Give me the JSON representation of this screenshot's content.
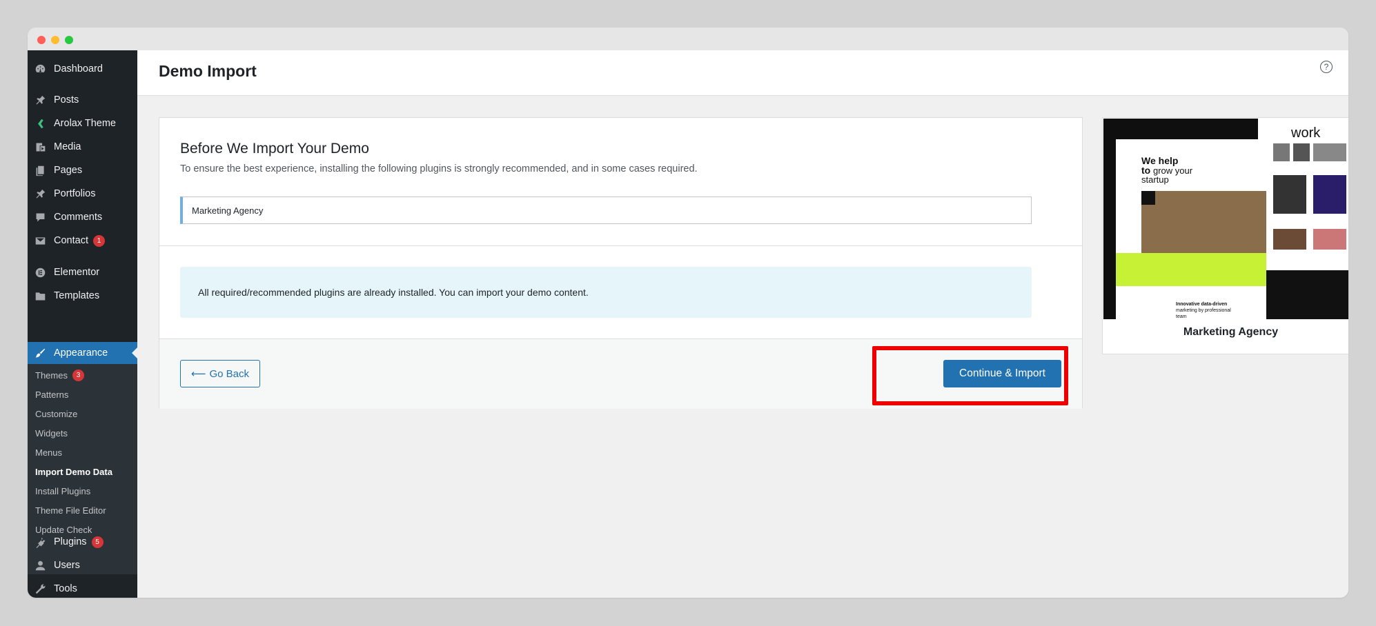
{
  "window": {
    "traffic_lights": [
      "close",
      "minimize",
      "zoom"
    ]
  },
  "sidebar": {
    "items": [
      {
        "label": "Dashboard",
        "icon": "dashboard-icon"
      },
      {
        "label": "Posts",
        "icon": "pin-icon"
      },
      {
        "label": "Arolax Theme",
        "icon": "theme-leaf-icon"
      },
      {
        "label": "Media",
        "icon": "media-icon"
      },
      {
        "label": "Pages",
        "icon": "pages-icon"
      },
      {
        "label": "Portfolios",
        "icon": "pin-icon"
      },
      {
        "label": "Comments",
        "icon": "comment-icon"
      },
      {
        "label": "Contact",
        "icon": "mail-icon",
        "badge": "1"
      },
      {
        "label": "Elementor",
        "icon": "elementor-icon"
      },
      {
        "label": "Templates",
        "icon": "folder-icon"
      },
      {
        "label": "Appearance",
        "icon": "brush-icon"
      },
      {
        "label": "Plugins",
        "icon": "plugin-icon",
        "badge": "5"
      },
      {
        "label": "Users",
        "icon": "user-icon"
      },
      {
        "label": "Tools",
        "icon": "wrench-icon"
      }
    ],
    "submenu": [
      {
        "label": "Themes",
        "badge": "3"
      },
      {
        "label": "Patterns"
      },
      {
        "label": "Customize"
      },
      {
        "label": "Widgets"
      },
      {
        "label": "Menus"
      },
      {
        "label": "Import Demo Data"
      },
      {
        "label": "Install Plugins"
      },
      {
        "label": "Theme File Editor"
      },
      {
        "label": "Update Check"
      }
    ]
  },
  "header": {
    "title": "Demo Import",
    "help_icon": "question-icon",
    "help_glyph": "?"
  },
  "main": {
    "heading": "Before We Import Your Demo",
    "description": "To ensure the best experience, installing the following plugins is strongly recommended, and in some cases required.",
    "demo_name": "Marketing Agency",
    "notice": "All required/recommended plugins are already installed. You can import your demo content.",
    "back_arrow": "⟵",
    "back_label": "Go Back",
    "continue_label": "Continue & Import"
  },
  "preview": {
    "caption": "Marketing Agency",
    "thumb": {
      "work": "work",
      "we_help": "We help",
      "to": "to",
      "grow_your": "grow your",
      "startup": "startup",
      "innovative": "Innovative data-driven",
      "marketing": "marketing by professional",
      "team": "team"
    }
  },
  "colors": {
    "accent": "#2271b1",
    "sidebar_bg": "#1d2327",
    "badge": "#d63638",
    "highlight": "#ee0000",
    "notice_bg": "#e5f5fa",
    "lime": "#c6f135"
  }
}
